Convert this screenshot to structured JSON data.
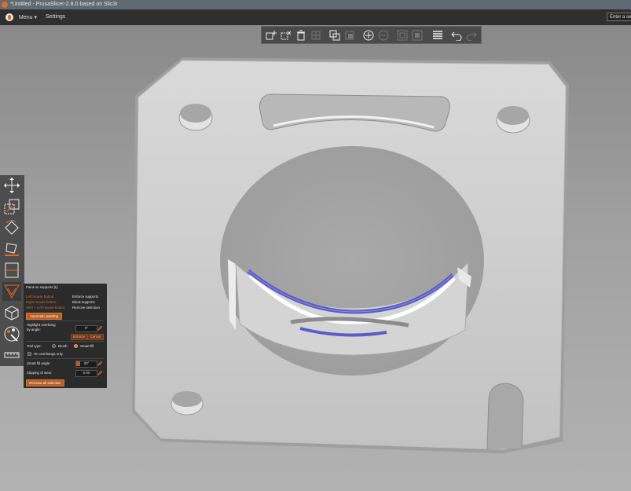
{
  "window": {
    "title": "*Untitled - PrusaSlicer-2.8.0 based on Slic3r"
  },
  "menubar": {
    "menu_label": "Menu",
    "settings_label": "Settings",
    "search_placeholder": "Enter a search term"
  },
  "toolbar": {
    "buttons": [
      "add-icon",
      "delete-icon",
      "delete-all-icon",
      "arrange-icon",
      "copy-icon",
      "paste-icon",
      "add-instance-icon",
      "remove-instance-icon",
      "split-objects-icon",
      "split-parts-icon",
      "layers-editing-icon",
      "undo-icon",
      "redo-icon"
    ]
  },
  "sidetools": {
    "items": [
      "move-icon",
      "scale-icon",
      "rotate-icon",
      "place-on-face-icon",
      "cut-icon",
      "support-painting-icon",
      "seam-painting-icon",
      "mmu-painting-icon",
      "measure-icon"
    ]
  },
  "support_panel": {
    "title": "Paint-on supports [L]",
    "shortcuts": [
      {
        "key": "Left mouse button:",
        "action": "Enforce supports"
      },
      {
        "key": "Right mouse button:",
        "action": "Block supports"
      },
      {
        "key": "Shift + Left mouse button:",
        "action": "Remove selection"
      }
    ],
    "auto_button": "Automatic painting",
    "highlight_label_1": "Highlight overhang",
    "highlight_label_2": "by angle:",
    "angle_value": "0°",
    "enforce_label": "Enforce",
    "cancel_label": "Cancel",
    "tool_type_label": "Tool type:",
    "brush_label": "Brush",
    "smart_fill_label": "Smart fill",
    "on_overhangs_label": "On overhangs only",
    "smart_fill_angle_label": "Smart fill angle:",
    "smart_fill_angle_value": "30°",
    "clipping_label": "Clipping of view:",
    "clipping_value": "0.00",
    "remove_button": "Remove all selection"
  },
  "colors": {
    "accent": "#e06a2a",
    "paint": "#5a5cc8",
    "plate": "#d2d2d2"
  }
}
